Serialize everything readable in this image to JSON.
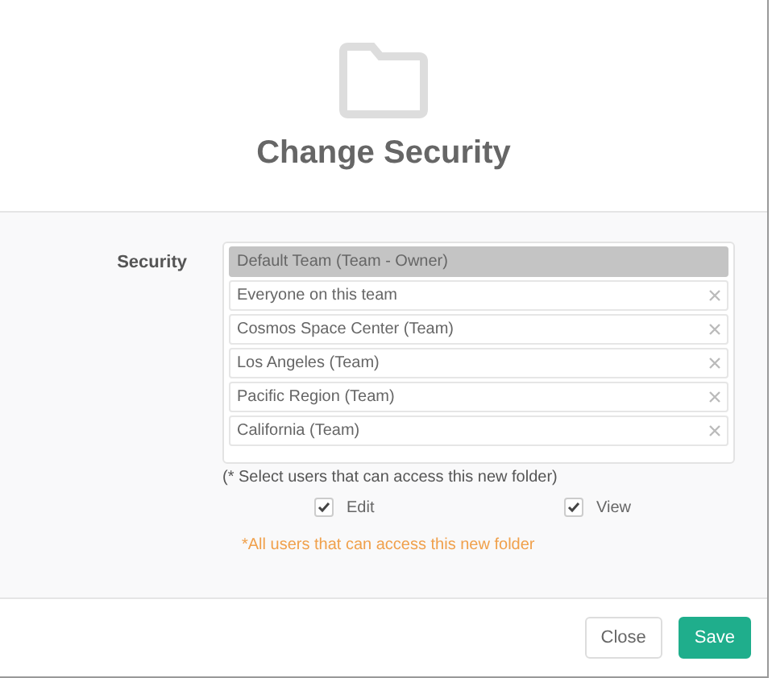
{
  "dialog": {
    "title": "Change Security"
  },
  "security": {
    "label": "Security",
    "items": [
      {
        "label": "Default Team (Team - Owner)",
        "selected": true,
        "removable": false
      },
      {
        "label": "Everyone on this team",
        "selected": false,
        "removable": true
      },
      {
        "label": "Cosmos Space Center (Team)",
        "selected": false,
        "removable": true
      },
      {
        "label": "Los Angeles (Team)",
        "selected": false,
        "removable": true
      },
      {
        "label": "Pacific Region (Team)",
        "selected": false,
        "removable": true
      },
      {
        "label": "California (Team)",
        "selected": false,
        "removable": true
      }
    ],
    "hint": "(* Select users that can access this new folder)",
    "permissions": [
      {
        "label": "Edit",
        "checked": true
      },
      {
        "label": "View",
        "checked": true
      }
    ],
    "note": "*All users that can access this new folder"
  },
  "buttons": [
    {
      "label": "Close",
      "kind": "secondary"
    },
    {
      "label": "Save",
      "kind": "primary"
    }
  ]
}
